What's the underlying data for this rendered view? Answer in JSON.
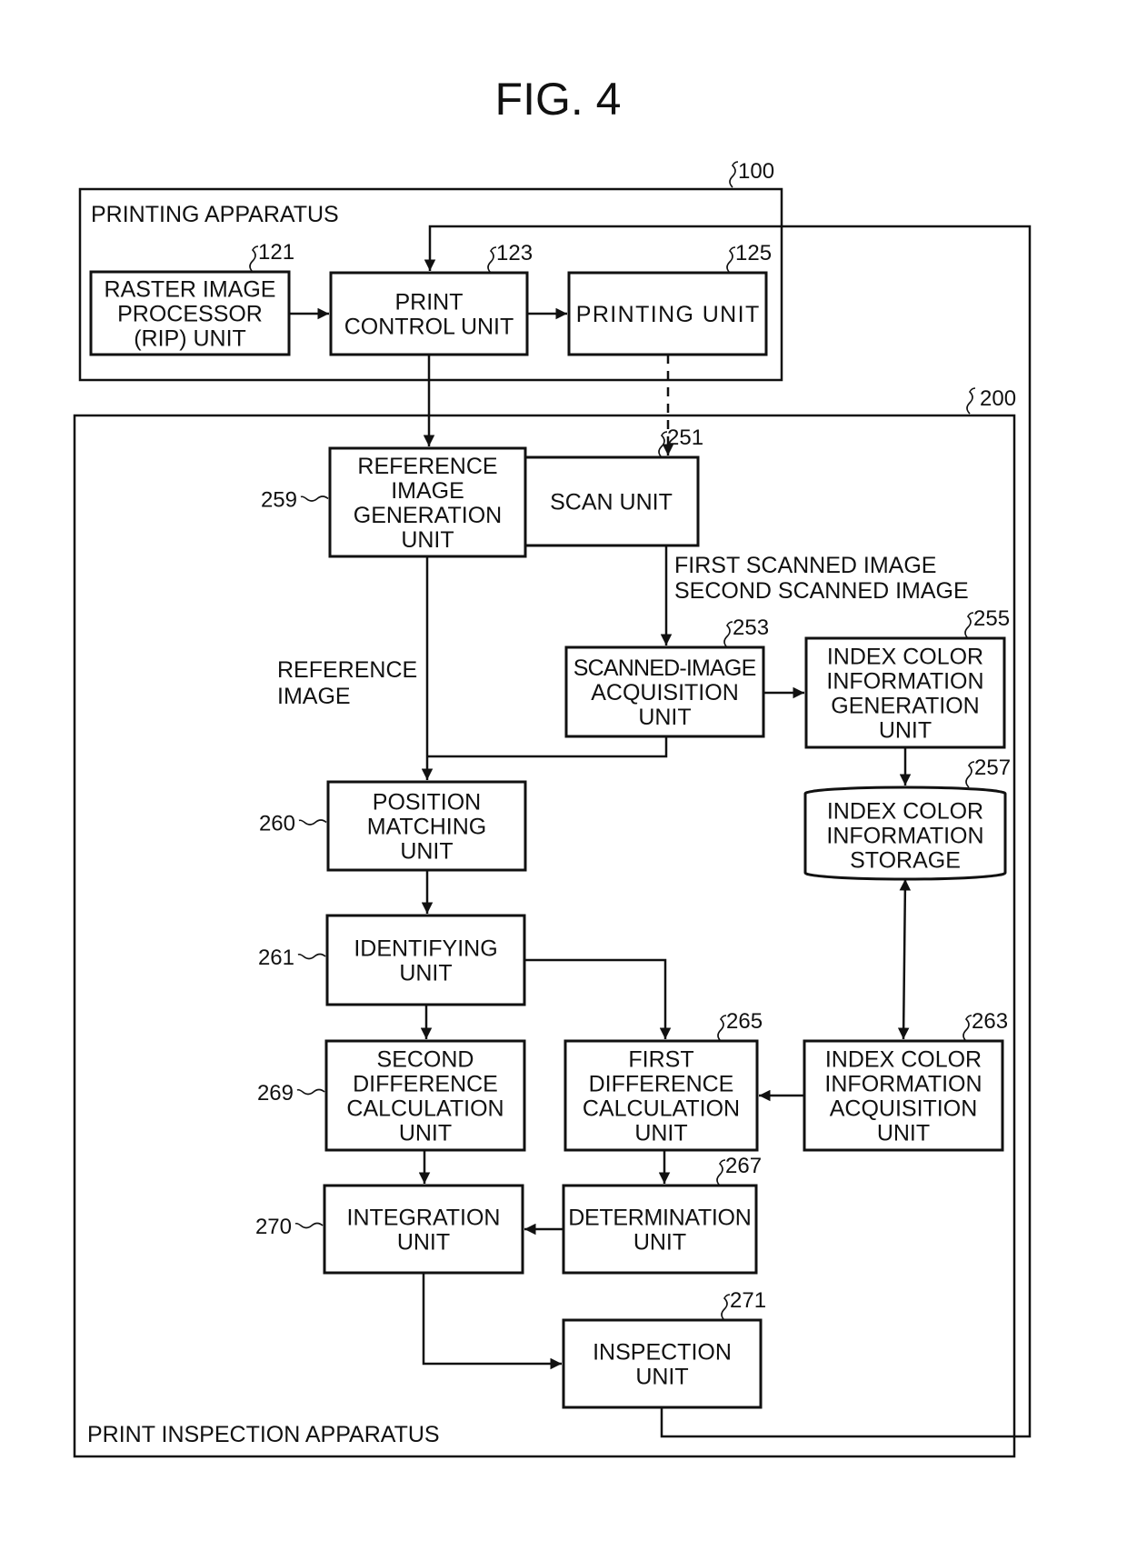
{
  "figure": {
    "title": "FIG. 4"
  },
  "apparatus": [
    {
      "id": "printing-apparatus",
      "ref": "100",
      "label": "PRINTING APPARATUS"
    },
    {
      "id": "print-inspection-apparatus",
      "ref": "200",
      "label": "PRINT INSPECTION APPARATUS"
    }
  ],
  "blocks": [
    {
      "id": "rip-unit",
      "ref": "121",
      "lines": [
        "RASTER IMAGE",
        "PROCESSOR",
        "(RIP) UNIT"
      ],
      "shape": "rect"
    },
    {
      "id": "print-control-unit",
      "ref": "123",
      "lines": [
        "PRINT",
        "CONTROL UNIT"
      ],
      "shape": "rect"
    },
    {
      "id": "printing-unit",
      "ref": "125",
      "lines": [
        "PRINTING UNIT"
      ],
      "shape": "rect"
    },
    {
      "id": "scan-unit",
      "ref": "251",
      "lines": [
        "SCAN UNIT"
      ],
      "shape": "rect"
    },
    {
      "id": "scanned-image-acquisition-unit",
      "ref": "253",
      "lines": [
        "SCANNED-IMAGE",
        "ACQUISITION",
        "UNIT"
      ],
      "shape": "rect"
    },
    {
      "id": "index-color-information-generation-unit",
      "ref": "255",
      "lines": [
        "INDEX COLOR",
        "INFORMATION",
        "GENERATION",
        "UNIT"
      ],
      "shape": "rect"
    },
    {
      "id": "index-color-information-storage",
      "ref": "257",
      "lines": [
        "INDEX COLOR",
        "INFORMATION",
        "STORAGE"
      ],
      "shape": "cylinder"
    },
    {
      "id": "reference-image-generation-unit",
      "ref": "259",
      "lines": [
        "REFERENCE",
        "IMAGE",
        "GENERATION",
        "UNIT"
      ],
      "shape": "rect"
    },
    {
      "id": "position-matching-unit",
      "ref": "260",
      "lines": [
        "POSITION",
        "MATCHING",
        "UNIT"
      ],
      "shape": "rect"
    },
    {
      "id": "identifying-unit",
      "ref": "261",
      "lines": [
        "IDENTIFYING",
        "UNIT"
      ],
      "shape": "rect"
    },
    {
      "id": "index-color-information-acquisition-unit",
      "ref": "263",
      "lines": [
        "INDEX COLOR",
        "INFORMATION",
        "ACQUISITION",
        "UNIT"
      ],
      "shape": "rect"
    },
    {
      "id": "first-difference-calculation-unit",
      "ref": "265",
      "lines": [
        "FIRST",
        "DIFFERENCE",
        "CALCULATION",
        "UNIT"
      ],
      "shape": "rect"
    },
    {
      "id": "determination-unit",
      "ref": "267",
      "lines": [
        "DETERMINATION",
        "UNIT"
      ],
      "shape": "rect"
    },
    {
      "id": "second-difference-calculation-unit",
      "ref": "269",
      "lines": [
        "SECOND",
        "DIFFERENCE",
        "CALCULATION",
        "UNIT"
      ],
      "shape": "rect"
    },
    {
      "id": "integration-unit",
      "ref": "270",
      "lines": [
        "INTEGRATION",
        "UNIT"
      ],
      "shape": "rect"
    },
    {
      "id": "inspection-unit",
      "ref": "271",
      "lines": [
        "INSPECTION",
        "UNIT"
      ],
      "shape": "rect"
    }
  ],
  "annotations": {
    "scanned_images": [
      "FIRST SCANNED IMAGE",
      "SECOND SCANNED IMAGE"
    ],
    "reference_image": [
      "REFERENCE",
      "IMAGE"
    ]
  },
  "connections": [
    {
      "from": "rip-unit",
      "to": "print-control-unit",
      "style": "solid"
    },
    {
      "from": "print-control-unit",
      "to": "printing-unit",
      "style": "solid"
    },
    {
      "from": "print-control-unit",
      "to": "reference-image-generation-unit",
      "style": "solid"
    },
    {
      "from": "printing-unit",
      "to": "scan-unit",
      "style": "dashed"
    },
    {
      "from": "scan-unit",
      "to": "scanned-image-acquisition-unit",
      "style": "solid",
      "label": "FIRST SCANNED IMAGE / SECOND SCANNED IMAGE"
    },
    {
      "from": "scanned-image-acquisition-unit",
      "to": "index-color-information-generation-unit",
      "style": "solid"
    },
    {
      "from": "index-color-information-generation-unit",
      "to": "index-color-information-storage",
      "style": "solid"
    },
    {
      "from": "reference-image-generation-unit",
      "to": "position-matching-unit",
      "style": "solid",
      "label": "REFERENCE IMAGE"
    },
    {
      "from": "scanned-image-acquisition-unit",
      "to": "position-matching-unit",
      "style": "solid"
    },
    {
      "from": "position-matching-unit",
      "to": "identifying-unit",
      "style": "solid"
    },
    {
      "from": "identifying-unit",
      "to": "second-difference-calculation-unit",
      "style": "solid"
    },
    {
      "from": "identifying-unit",
      "to": "first-difference-calculation-unit",
      "style": "solid"
    },
    {
      "from": "index-color-information-storage",
      "to": "index-color-information-acquisition-unit",
      "style": "bidirectional"
    },
    {
      "from": "index-color-information-acquisition-unit",
      "to": "first-difference-calculation-unit",
      "style": "solid"
    },
    {
      "from": "first-difference-calculation-unit",
      "to": "determination-unit",
      "style": "solid"
    },
    {
      "from": "second-difference-calculation-unit",
      "to": "integration-unit",
      "style": "solid"
    },
    {
      "from": "determination-unit",
      "to": "integration-unit",
      "style": "solid"
    },
    {
      "from": "integration-unit",
      "to": "inspection-unit",
      "style": "solid"
    },
    {
      "from": "inspection-unit",
      "to": "print-control-unit",
      "style": "solid"
    }
  ]
}
